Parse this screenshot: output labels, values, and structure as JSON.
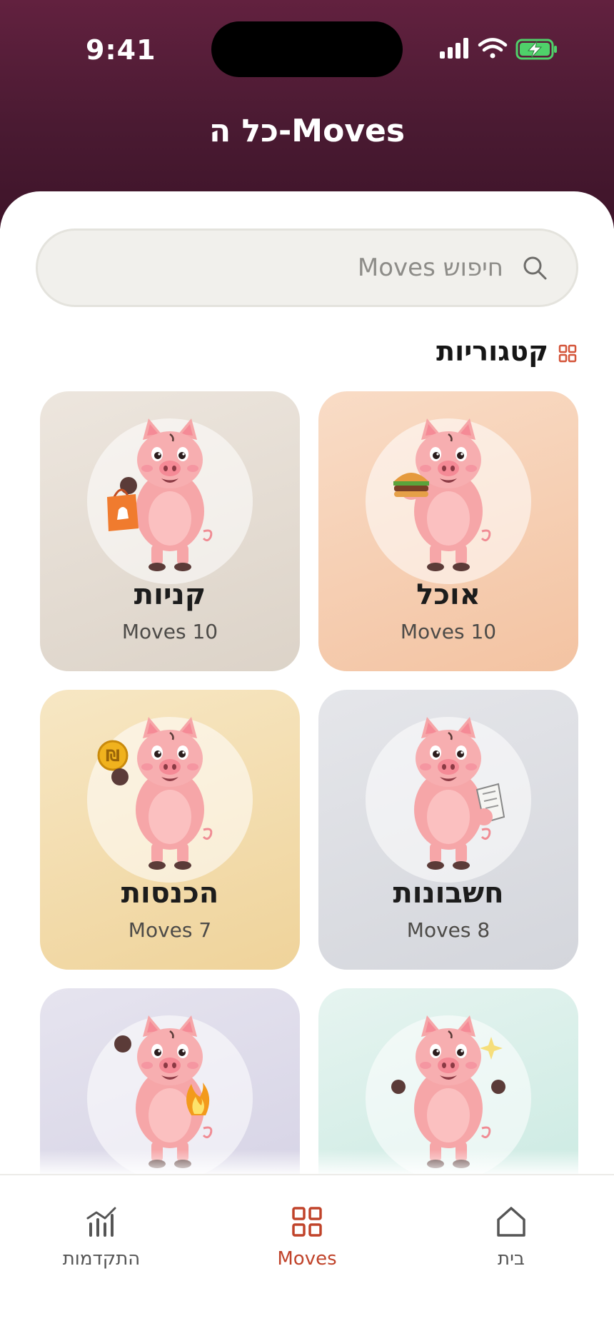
{
  "status_bar": {
    "time": "9:41"
  },
  "header": {
    "title": "כל ה-Moves"
  },
  "search": {
    "placeholder": "חיפוש Moves"
  },
  "categories_section": {
    "title": "קטגוריות"
  },
  "categories": [
    {
      "title": "אוכל",
      "count_label": "Moves 10",
      "bg_from": "#f9dcc6",
      "bg_to": "#f3c3a2",
      "prop": "burger"
    },
    {
      "title": "קניות",
      "count_label": "Moves 10",
      "bg_from": "#ede6de",
      "bg_to": "#dcd3c8",
      "prop": "bag"
    },
    {
      "title": "חשבונות",
      "count_label": "Moves 8",
      "bg_from": "#e5e6ea",
      "bg_to": "#d4d6dc",
      "prop": "receipt"
    },
    {
      "title": "הכנסות",
      "count_label": "Moves 7",
      "bg_from": "#f7e7c4",
      "bg_to": "#efd39a",
      "prop": "coin"
    },
    {
      "title": "",
      "count_label": "",
      "bg_from": "#e6f4f0",
      "bg_to": "#c5e8df",
      "prop": "sparkle"
    },
    {
      "title": "",
      "count_label": "",
      "bg_from": "#e6e4ef",
      "bg_to": "#d2cfe3",
      "prop": "flame"
    }
  ],
  "tabbar": {
    "home_label": "בית",
    "moves_label": "Moves",
    "progress_label": "התקדמות",
    "active_tab": "moves",
    "active_color": "#c0432a"
  }
}
